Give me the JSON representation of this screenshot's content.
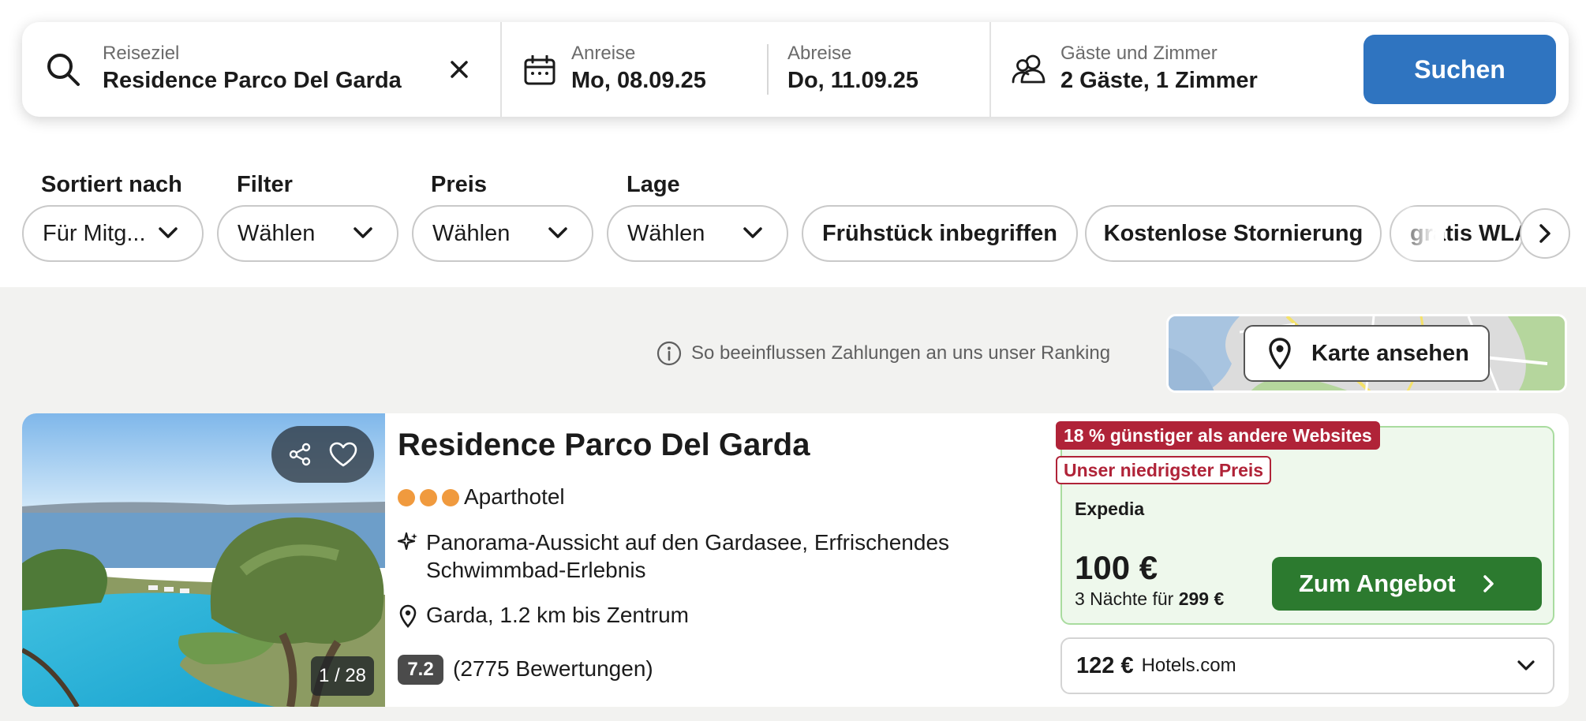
{
  "search": {
    "destination_label": "Reiseziel",
    "destination_value": "Residence Parco Del Garda",
    "checkin_label": "Anreise",
    "checkin_value": "Mo, 08.09.25",
    "checkout_label": "Abreise",
    "checkout_value": "Do, 11.09.25",
    "guests_label": "Gäste und Zimmer",
    "guests_value": "2 Gäste, 1 Zimmer",
    "search_button": "Suchen"
  },
  "filters": {
    "sort": {
      "label": "Sortiert nach",
      "value": "Für Mitg..."
    },
    "filter": {
      "label": "Filter",
      "value": "Wählen"
    },
    "price": {
      "label": "Preis",
      "value": "Wählen"
    },
    "location": {
      "label": "Lage",
      "value": "Wählen"
    },
    "chips": [
      "Frühstück inbegriffen",
      "Kostenlose Stornierung",
      "gratis WLAN"
    ]
  },
  "ranking_note": "So beeinflussen Zahlungen an uns unser Ranking",
  "map_button": "Karte ansehen",
  "hotel": {
    "name": "Residence Parco Del Garda",
    "stars": 3,
    "type": "Aparthotel",
    "highlights": "Panorama-Aussicht auf den Gardasee, Erfrischendes Schwimmbad-Erlebnis",
    "location": "Garda, 1.2 km bis Zentrum",
    "rating": "7.2",
    "reviews": "(2775 Bewertungen)",
    "photo_counter": "1 / 28",
    "deal": {
      "savings_badge": "18 % günstiger als andere Websites",
      "lowest_badge": "Unser niedrigster Preis",
      "provider": "Expedia",
      "price": "100 €",
      "total_prefix": "3 Nächte für",
      "total_price": "299 €",
      "button": "Zum Angebot"
    },
    "alt_offer": {
      "price": "122 €",
      "provider": "Hotels.com"
    }
  },
  "colors": {
    "accent_blue": "#2f74c0",
    "deal_green": "#2c7a2f",
    "badge_red": "#b02338",
    "star_orange": "#f09a3e"
  }
}
